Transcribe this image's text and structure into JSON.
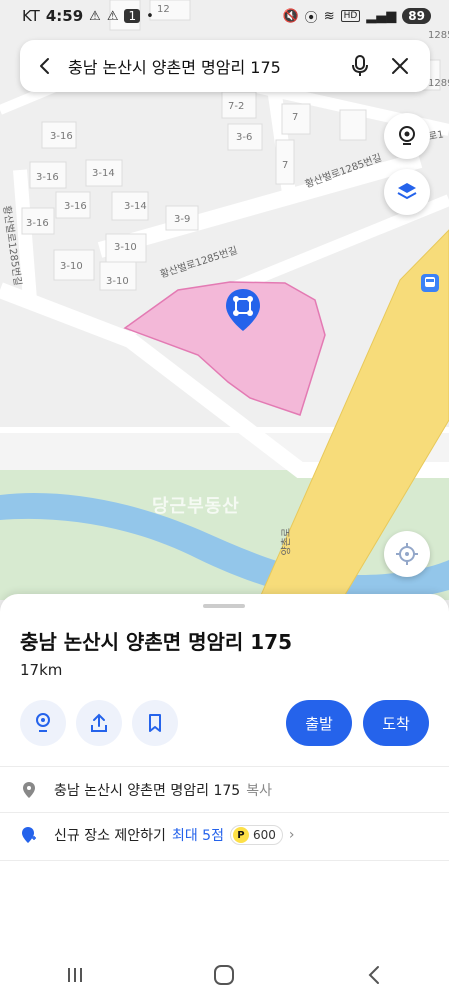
{
  "status_bar": {
    "carrier": "KT",
    "time": "4:59",
    "notif_count": "1",
    "battery": "89",
    "hd_label": "HD"
  },
  "search": {
    "query": "충남 논산시 양촌면 명암리 175",
    "icons": [
      "back-arrow-icon",
      "microphone-icon",
      "close-icon"
    ]
  },
  "map": {
    "building_labels": [
      "12",
      "1285",
      "3-16",
      "3-16",
      "3-16",
      "3-14",
      "3-16",
      "3-14",
      "3-9",
      "3-10",
      "3-10",
      "3-10",
      "7-2",
      "3-6",
      "7",
      "7",
      "1289"
    ],
    "road_labels": [
      "황산벌로1285번길",
      "황산벌로1285번길",
      "황산벌로1285번길",
      "양촌로",
      "로1"
    ],
    "watermark": "당근부동산",
    "colors": {
      "parcel": "#f3b8d8",
      "main_road": "#f7dc7a",
      "river": "#8fc3ea",
      "green": "#cfe7c6"
    }
  },
  "sheet": {
    "title": "충남 논산시 양촌면 명암리 175",
    "distance": "17km",
    "depart_label": "출발",
    "arrive_label": "도착",
    "address": "충남 논산시 양촌면 명암리 175",
    "copy_label": "복사",
    "suggest_label": "신규 장소 제안하기",
    "suggest_reward": "최대 5점",
    "point_badge": "P",
    "point_value": "600",
    "accent": "#2563eb"
  }
}
